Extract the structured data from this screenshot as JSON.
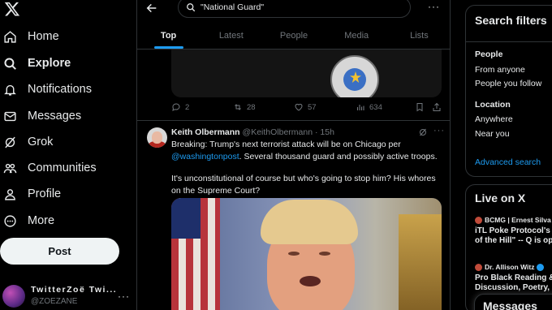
{
  "sidebar": {
    "logo": "X",
    "items": [
      {
        "label": "Home",
        "icon": "home-icon"
      },
      {
        "label": "Explore",
        "icon": "search-icon",
        "active": true
      },
      {
        "label": "Notifications",
        "icon": "bell-icon"
      },
      {
        "label": "Messages",
        "icon": "envelope-icon"
      },
      {
        "label": "Grok",
        "icon": "grok-icon"
      },
      {
        "label": "Communities",
        "icon": "people-icon"
      },
      {
        "label": "Profile",
        "icon": "person-icon"
      },
      {
        "label": "More",
        "icon": "more-circle-icon"
      }
    ],
    "post_label": "Post",
    "account": {
      "name": "TwitterZoë Twi...",
      "handle": "@ZOEZANE",
      "more": "···"
    }
  },
  "header": {
    "search_value": "\"National Guard\"",
    "more": "···",
    "tabs": [
      "Top",
      "Latest",
      "People",
      "Media",
      "Lists"
    ],
    "active_tab": "Top"
  },
  "prev_tweet": {
    "replies": "2",
    "reposts": "28",
    "likes": "57",
    "views": "634"
  },
  "tweet": {
    "author": "Keith Olbermann",
    "handle": "@KeithOlbermann",
    "sep": "·",
    "time": "15h",
    "more": "···",
    "text_before": "Breaking: Trump's next terrorist attack will be on Chicago per ",
    "mention": "@washingtonpost",
    "text_after": ". Several thousand guard and possibly active troops.",
    "text_2": "It's unconstitutional of course but who's going to stop him? His whores on the Supreme Court?"
  },
  "search_filters": {
    "title": "Search filters",
    "people_label": "People",
    "people_opts": [
      "From anyone",
      "People you follow"
    ],
    "location_label": "Location",
    "location_opts": [
      "Anywhere",
      "Near you"
    ],
    "advanced": "Advanced search"
  },
  "live": {
    "title": "Live on X",
    "items": [
      {
        "who": "BCMG | Ernest Silva",
        "title_1": "iTL Poke Protocol's F",
        "title_2": "of the Hill\" -- Q is ope"
      },
      {
        "who": "Dr. Allison Witz",
        "title_1": "Pro Black Reading &",
        "title_2": "Discussion, Poetry, Pr"
      }
    ]
  },
  "messages_bar": {
    "title": "Messages"
  },
  "colors": {
    "accent": "#1d9bf0",
    "background": "#000000",
    "border": "#2f3336",
    "muted": "#71767b"
  }
}
